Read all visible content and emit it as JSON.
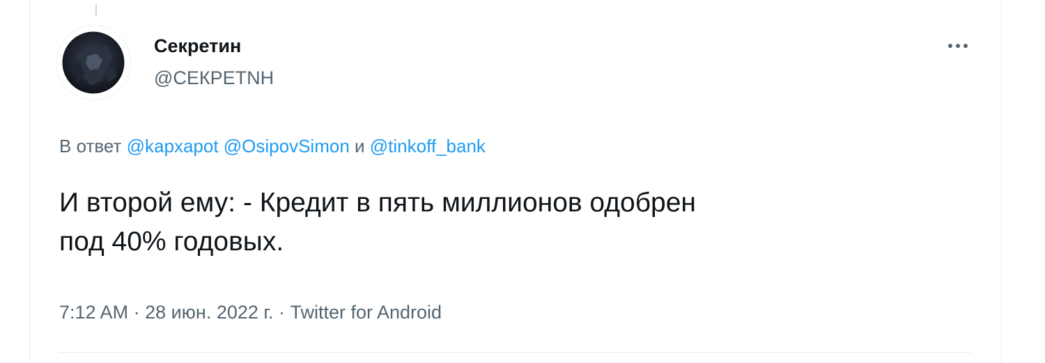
{
  "author": {
    "display_name": "Секретин",
    "handle": "@СЕКРЕТNH"
  },
  "reply": {
    "prefix": "В ответ ",
    "mention_1": "@kapxapot",
    "space_1": " ",
    "mention_2": "@OsipovSimon",
    "conjunction": " и ",
    "mention_3": "@tinkoff_bank"
  },
  "tweet": {
    "text": "И второй ему: - Кредит в пять миллионов одобрен\nпод 40% годовых."
  },
  "meta": {
    "time": "7:12 AM",
    "separator_1": " · ",
    "date": "28 июн. 2022 г.",
    "separator_2": " · ",
    "source": "Twitter for Android"
  },
  "icons": {
    "more": "more-horizontal-icon",
    "avatar": "avatar-image"
  },
  "colors": {
    "link": "#1d9bf0",
    "secondary_text": "#536471",
    "primary_text": "#0f1419"
  }
}
